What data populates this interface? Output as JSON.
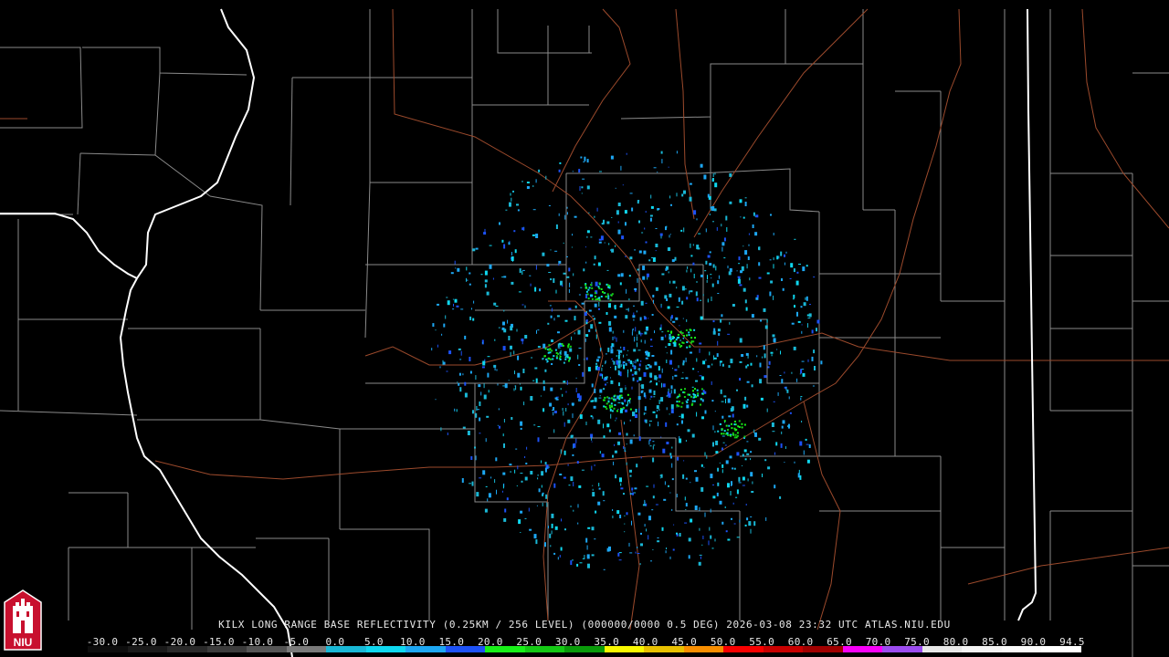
{
  "caption": {
    "text": "KILX LONG RANGE BASE REFLECTIVITY (0.25KM / 256 LEVEL) (000000/0000 0.5 DEG) 2026-03-08 23:32 UTC  ATLAS.NIU.EDU"
  },
  "legend": {
    "labels": [
      "-30.0",
      "-25.0",
      "-20.0",
      "-15.0",
      "-10.0",
      "-5.0",
      "0.0",
      "5.0",
      "10.0",
      "15.0",
      "20.0",
      "25.0",
      "30.0",
      "35.0",
      "40.0",
      "45.0",
      "50.0",
      "55.0",
      "60.0",
      "65.0",
      "70.0",
      "75.0",
      "80.0",
      "85.0",
      "90.0",
      "94.5"
    ],
    "colors": [
      "#0d0d0d",
      "#1a1a1a",
      "#2a2a2a",
      "#3c3c3c",
      "#555555",
      "#7a7a7a",
      "#19b8d6",
      "#0fd8f0",
      "#1da7f3",
      "#1d52f7",
      "#18f018",
      "#14c814",
      "#0a9a0a",
      "#f8f800",
      "#e8c000",
      "#f88e00",
      "#f80000",
      "#c80000",
      "#a00000",
      "#f800f8",
      "#9c4cf0",
      "#e8e8e8",
      "#f4f4f4",
      "#fafafa",
      "#ffffff"
    ],
    "unit": ""
  },
  "logo": {
    "text": "NIU",
    "color": "#c8102e"
  },
  "map": {
    "radar_site": "KILX",
    "background": "#000000",
    "county_line_color": "#8a8a8a",
    "state_line_color": "#ffffff",
    "road_color": "#9c4a2c"
  }
}
